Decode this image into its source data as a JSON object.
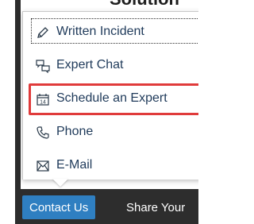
{
  "background": {
    "heading_partial": "Solution"
  },
  "menu": {
    "items": [
      {
        "label": "Written Incident",
        "icon": "pencil-icon"
      },
      {
        "label": "Expert Chat",
        "icon": "chat-bubbles-icon"
      },
      {
        "label": "Schedule an Expert",
        "icon": "calendar-icon"
      },
      {
        "label": "Phone",
        "icon": "phone-icon"
      },
      {
        "label": "E-Mail",
        "icon": "envelope-icon"
      }
    ],
    "highlighted_index": 2,
    "focused_index": 0
  },
  "toolbar": {
    "contact_label": "Contact Us",
    "share_label": "Share Your"
  },
  "colors": {
    "menu_text": "#1f3a5a",
    "highlight_border": "#e03b3b",
    "contact_button_bg": "#2f7fc1",
    "toolbar_bg": "#2d2d2d"
  }
}
